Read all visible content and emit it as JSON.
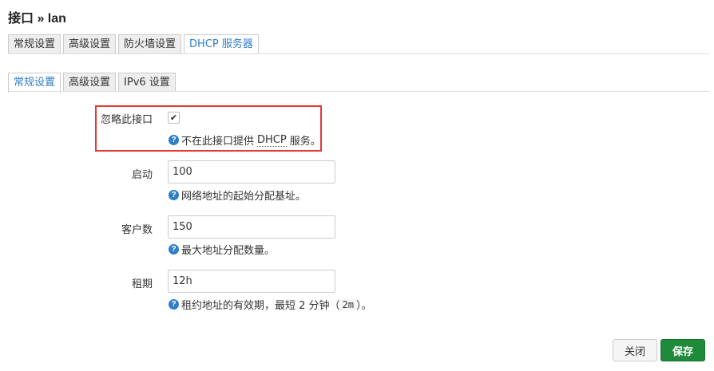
{
  "page": {
    "title": "接口 » lan"
  },
  "top_tabs": [
    {
      "label": "常规设置",
      "active": false
    },
    {
      "label": "高级设置",
      "active": false
    },
    {
      "label": "防火墙设置",
      "active": false
    },
    {
      "label": "DHCP 服务器",
      "active": true
    }
  ],
  "sub_tabs": [
    {
      "label": "常规设置",
      "active": true
    },
    {
      "label": "高级设置",
      "active": false
    },
    {
      "label": "IPv6 设置",
      "active": false
    }
  ],
  "ignore": {
    "label": "忽略此接口",
    "checked": true,
    "help_prefix": "不在此接口提供",
    "help_abbr": "DHCP",
    "help_suffix": "服务。"
  },
  "start": {
    "label": "启动",
    "value": "100",
    "help": "网络地址的起始分配基址。"
  },
  "limit": {
    "label": "客户数",
    "value": "150",
    "help": "最大地址分配数量。"
  },
  "lease": {
    "label": "租期",
    "value": "12h",
    "help_prefix": "租约地址的有效期，最短 2 分钟（",
    "help_code": "2m",
    "help_suffix": "）。"
  },
  "buttons": {
    "close": "关闭",
    "save": "保存"
  },
  "colors": {
    "accent": "#2f7ec7",
    "save": "#1e8a3a",
    "highlight": "#e53935"
  },
  "icons": {
    "help": "question-circle-icon",
    "check": "checkmark-icon"
  }
}
